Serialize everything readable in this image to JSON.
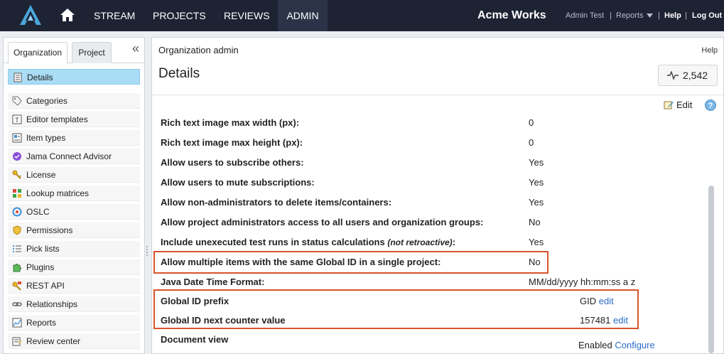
{
  "nav": {
    "items": [
      "STREAM",
      "PROJECTS",
      "REVIEWS",
      "ADMIN"
    ],
    "active": "ADMIN",
    "brand": "Acme Works",
    "user": "Admin Test",
    "reports": "Reports",
    "help": "Help",
    "logout": "Log Out",
    "sep": "|"
  },
  "sidebar": {
    "tabs": [
      "Organization",
      "Project"
    ],
    "collapse": "«",
    "items": [
      {
        "label": "Details",
        "icon": "details-icon"
      },
      {
        "label": "Categories",
        "icon": "tag-icon"
      },
      {
        "label": "Editor templates",
        "icon": "template-icon"
      },
      {
        "label": "Item types",
        "icon": "item-types-icon"
      },
      {
        "label": "Jama Connect Advisor",
        "icon": "advisor-icon"
      },
      {
        "label": "License",
        "icon": "key-icon"
      },
      {
        "label": "Lookup matrices",
        "icon": "matrix-icon"
      },
      {
        "label": "OSLC",
        "icon": "oslc-icon"
      },
      {
        "label": "Permissions",
        "icon": "shield-icon"
      },
      {
        "label": "Pick lists",
        "icon": "list-icon"
      },
      {
        "label": "Plugins",
        "icon": "puzzle-icon"
      },
      {
        "label": "REST API",
        "icon": "api-key-icon"
      },
      {
        "label": "Relationships",
        "icon": "link-icon"
      },
      {
        "label": "Reports",
        "icon": "chart-icon"
      },
      {
        "label": "Review center",
        "icon": "review-icon"
      }
    ]
  },
  "main": {
    "breadcrumb": "Organization admin",
    "help": "Help",
    "title": "Details",
    "counter": "2,542",
    "edit": "Edit",
    "help_circle": "?",
    "rows": [
      {
        "label": "Rich text image max width (px):",
        "value": "0"
      },
      {
        "label": "Rich text image max height (px):",
        "value": "0"
      },
      {
        "label": "Allow users to subscribe others:",
        "value": "Yes"
      },
      {
        "label": "Allow users to mute subscriptions:",
        "value": "Yes"
      },
      {
        "label": "Allow non-administrators to delete items/containers:",
        "value": "Yes"
      },
      {
        "label": "Allow project administrators access to all users and organization groups:",
        "value": "No"
      },
      {
        "label": "Include unexecuted test runs in status calculations",
        "label_note": "(not retroactive)",
        "label_end": ":",
        "value": "Yes"
      },
      {
        "label": "Allow multiple items with the same Global ID in a single project:",
        "value": "No"
      },
      {
        "label": "Java Date Time Format:",
        "value": "MM/dd/yyyy hh:mm:ss a z"
      }
    ],
    "gid_prefix": {
      "label": "Global ID prefix",
      "value": "GID",
      "action": "edit"
    },
    "gid_counter": {
      "label": "Global ID next counter value",
      "value": "157481",
      "action": "edit"
    },
    "document_view": {
      "label": "Document view",
      "value": "Enabled",
      "action": "Configure"
    }
  },
  "colors": {
    "topbar": "#1e2333",
    "highlight": "#d9532b",
    "selected": "#aadcf5",
    "link": "#2a6cc8"
  }
}
